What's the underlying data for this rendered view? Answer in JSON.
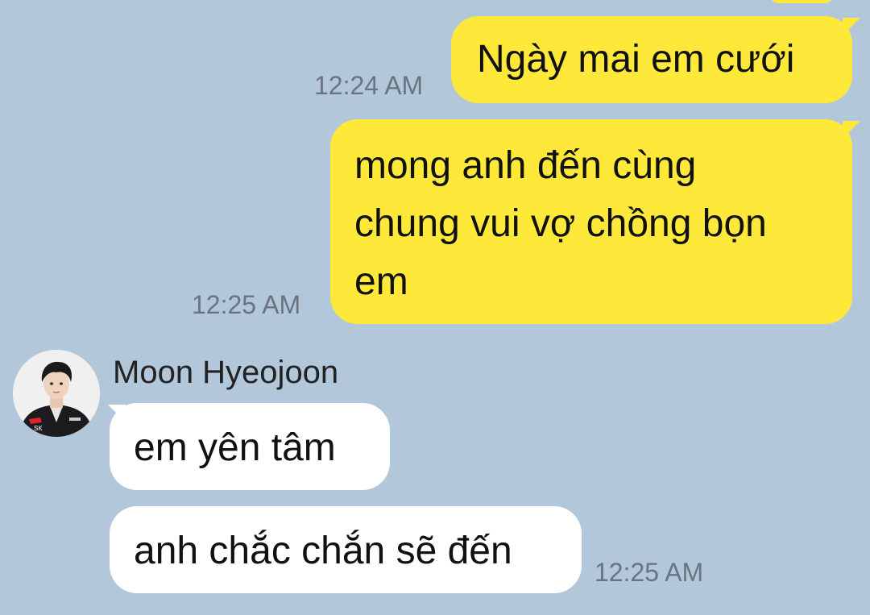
{
  "conversation": {
    "messages": [
      {
        "direction": "outgoing",
        "text": "Ngày mai em cưới",
        "time": "12:24 AM"
      },
      {
        "direction": "outgoing",
        "text": "mong anh đến cùng\nchung vui vợ chồng bọn\nem",
        "time": "12:25 AM"
      },
      {
        "direction": "incoming",
        "sender": "Moon Hyeojoon",
        "text": "em yên tâm",
        "time": ""
      },
      {
        "direction": "incoming",
        "sender": "Moon Hyeojoon",
        "text": "anh chắc chắn sẽ đến",
        "time": "12:25 AM"
      }
    ],
    "contact": {
      "name": "Moon Hyeojoon",
      "avatar_icon": "profile-photo-avatar"
    }
  },
  "theme": {
    "background": "#b2c7d9",
    "outgoing_bubble": "#fee93b",
    "incoming_bubble": "#ffffff",
    "timestamp_color": "#6a7480"
  }
}
